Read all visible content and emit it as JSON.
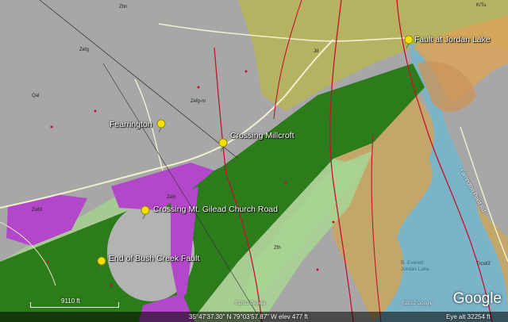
{
  "placemarks": [
    {
      "key": "fault-jordan-lake",
      "label": "Fault at Jordan Lake"
    },
    {
      "key": "fearrington",
      "label": "Fearrington"
    },
    {
      "key": "crossing-millcroft",
      "label": "Crossing Millcroft"
    },
    {
      "key": "crossing-mt-gilead",
      "label": "Crossing Mt. Gilead Church Road"
    },
    {
      "key": "end-bush-creek",
      "label": "End of Bush Creek Fault"
    }
  ],
  "map_labels": {
    "road": "Farrington Point Rd",
    "lake_line1": "B. Everett",
    "lake_line2": "Jordan Lake",
    "unit_qal": "Qal",
    "unit_zefg": "Zefg",
    "unit_zefg_m": "Zefg-m",
    "unit_zwfd": "Zwfd",
    "unit_zeih": "Zeih",
    "unit_jd": "Jd",
    "unit_kt": "K/Tu",
    "unit_zfh": "Zfh",
    "unit_trcs": "Trcsl/2",
    "unit_zhn": "Zhn"
  },
  "status": {
    "scale": "9110 ft",
    "coordinates": "35°47'37.30\" N    79°03'57.87\" W    elev  477 ft",
    "eye_alt": "Eye alt    32254 ft",
    "copyright": "©2012 Google",
    "copyright2": "©2012 Google",
    "brand": "Google"
  },
  "colors": {
    "bedrock_gray": "#a9a9a9",
    "dark_green": "#2e7d1a",
    "light_green": "#9fc78a",
    "magenta": "#b347c9",
    "tan": "#c9a867",
    "olive": "#b3b04f",
    "lake": "#7bb4c7",
    "fault_red": "#c8102e",
    "pin_yellow": "#f4e000"
  }
}
